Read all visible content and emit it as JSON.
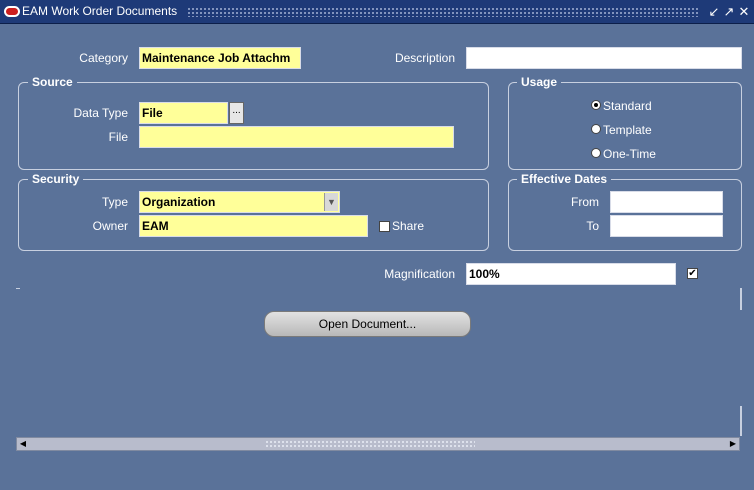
{
  "window": {
    "title": "EAM Work Order Documents",
    "minimize_icon": "minimize-icon",
    "maximize_icon": "maximize-icon",
    "close_icon": "close-icon"
  },
  "main": {
    "category_label": "Category",
    "category_value": "Maintenance Job Attachm",
    "description_label": "Description",
    "description_value": ""
  },
  "source": {
    "title": "Source",
    "data_type_label": "Data Type",
    "data_type_value": "File",
    "lov_label": "...",
    "file_label": "File",
    "file_value": ""
  },
  "usage": {
    "title": "Usage",
    "options": [
      "Standard",
      "Template",
      "One-Time"
    ],
    "selected": "Standard"
  },
  "security": {
    "title": "Security",
    "type_label": "Type",
    "type_value": "Organization",
    "owner_label": "Owner",
    "owner_value": "EAM",
    "share_label": "Share",
    "share_checked": false
  },
  "effective_dates": {
    "title": "Effective Dates",
    "from_label": "From",
    "from_value": "",
    "to_label": "To",
    "to_value": ""
  },
  "magnification": {
    "label": "Magnification",
    "value": "100%",
    "checked": true
  },
  "actions": {
    "open_document_label": "Open Document..."
  },
  "colors": {
    "background": "#5a7299",
    "titlebar": "#1e3a78",
    "required_field": "#ffff99"
  }
}
